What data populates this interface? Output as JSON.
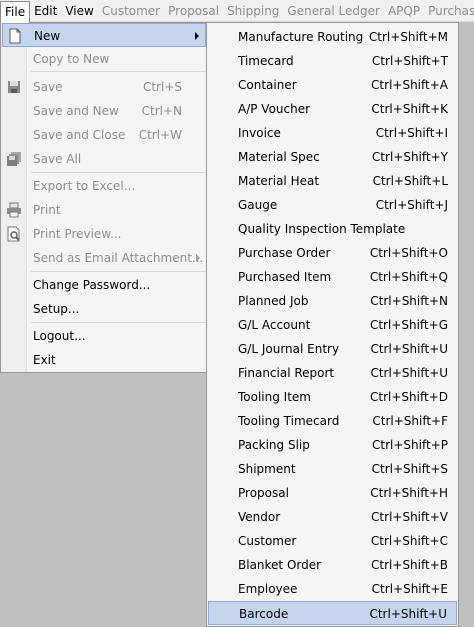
{
  "menubar": [
    {
      "label": "File",
      "state": "active"
    },
    {
      "label": "Edit",
      "state": "normal"
    },
    {
      "label": "View",
      "state": "normal"
    },
    {
      "label": "Customer",
      "state": "disabled"
    },
    {
      "label": "Proposal",
      "state": "disabled"
    },
    {
      "label": "Shipping",
      "state": "disabled"
    },
    {
      "label": "General Ledger",
      "state": "disabled"
    },
    {
      "label": "APQP",
      "state": "disabled"
    },
    {
      "label": "Purchasing",
      "state": "disabled"
    }
  ],
  "file_menu": {
    "new": {
      "label": "New",
      "icon": "new-document-icon"
    },
    "copy_to_new": {
      "label": "Copy to New"
    },
    "save": {
      "label": "Save",
      "shortcut": "Ctrl+S",
      "icon": "floppy-disk-icon"
    },
    "save_and_new": {
      "label": "Save and New",
      "shortcut": "Ctrl+N"
    },
    "save_and_close": {
      "label": "Save and Close",
      "shortcut": "Ctrl+W"
    },
    "save_all": {
      "label": "Save All",
      "icon": "save-all-icon"
    },
    "export_to_excel": {
      "label": "Export to Excel..."
    },
    "print": {
      "label": "Print",
      "icon": "printer-icon"
    },
    "print_preview": {
      "label": "Print Preview...",
      "icon": "print-preview-icon"
    },
    "send_email": {
      "label": "Send as Email Attachment..."
    },
    "change_password": {
      "label": "Change Password..."
    },
    "setup": {
      "label": "Setup..."
    },
    "logout": {
      "label": "Logout..."
    },
    "exit": {
      "label": "Exit"
    }
  },
  "new_submenu": [
    {
      "label": "Manufacture Routing",
      "shortcut": "Ctrl+Shift+M"
    },
    {
      "label": "Timecard",
      "shortcut": "Ctrl+Shift+T"
    },
    {
      "label": "Container",
      "shortcut": "Ctrl+Shift+A"
    },
    {
      "label": "A/P Voucher",
      "shortcut": "Ctrl+Shift+K"
    },
    {
      "label": "Invoice",
      "shortcut": "Ctrl+Shift+I"
    },
    {
      "label": "Material Spec",
      "shortcut": "Ctrl+Shift+Y"
    },
    {
      "label": "Material Heat",
      "shortcut": "Ctrl+Shift+L"
    },
    {
      "label": "Gauge",
      "shortcut": "Ctrl+Shift+J"
    },
    {
      "label": "Quality Inspection Template",
      "shortcut": ""
    },
    {
      "label": "Purchase Order",
      "shortcut": "Ctrl+Shift+O"
    },
    {
      "label": "Purchased Item",
      "shortcut": "Ctrl+Shift+Q"
    },
    {
      "label": "Planned Job",
      "shortcut": "Ctrl+Shift+N"
    },
    {
      "label": "G/L Account",
      "shortcut": "Ctrl+Shift+G"
    },
    {
      "label": "G/L Journal Entry",
      "shortcut": "Ctrl+Shift+U"
    },
    {
      "label": "Financial Report",
      "shortcut": "Ctrl+Shift+U"
    },
    {
      "label": "Tooling Item",
      "shortcut": "Ctrl+Shift+D"
    },
    {
      "label": "Tooling Timecard",
      "shortcut": "Ctrl+Shift+F"
    },
    {
      "label": "Packing Slip",
      "shortcut": "Ctrl+Shift+P"
    },
    {
      "label": "Shipment",
      "shortcut": "Ctrl+Shift+S"
    },
    {
      "label": "Proposal",
      "shortcut": "Ctrl+Shift+H"
    },
    {
      "label": "Vendor",
      "shortcut": "Ctrl+Shift+V"
    },
    {
      "label": "Customer",
      "shortcut": "Ctrl+Shift+C"
    },
    {
      "label": "Blanket Order",
      "shortcut": "Ctrl+Shift+B"
    },
    {
      "label": "Employee",
      "shortcut": "Ctrl+Shift+E"
    },
    {
      "label": "Barcode",
      "shortcut": "Ctrl+Shift+U"
    }
  ],
  "colors": {
    "highlight": "#c5d5ee",
    "highlight_border": "#8fa9d4",
    "disabled_text": "#8d8d8d",
    "background": "#c0c0c0"
  }
}
